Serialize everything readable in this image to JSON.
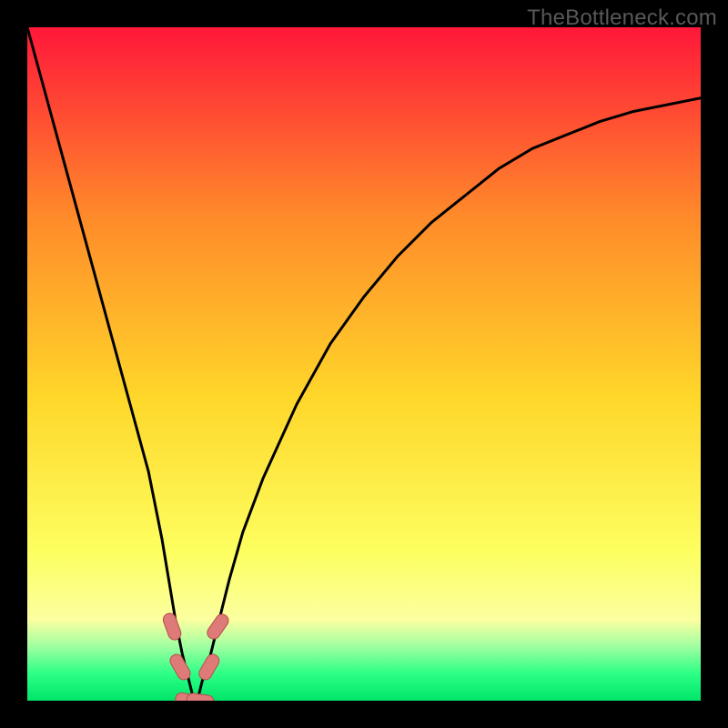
{
  "watermark": "TheBottleneck.com",
  "chart_data": {
    "type": "line",
    "title": "",
    "xlabel": "",
    "ylabel": "",
    "xlim": [
      0,
      100
    ],
    "ylim": [
      0,
      100
    ],
    "series": [
      {
        "name": "bottleneck-curve",
        "x": [
          0,
          3,
          6,
          9,
          12,
          15,
          18,
          20,
          21,
          22,
          23,
          24,
          24.5,
          25,
          25.5,
          26,
          27,
          28,
          29,
          30,
          32,
          35,
          40,
          45,
          50,
          55,
          60,
          65,
          70,
          75,
          80,
          85,
          90,
          95,
          100
        ],
        "values": [
          100,
          89,
          78,
          67,
          56,
          45,
          34,
          24,
          18,
          12,
          7,
          3,
          1,
          0,
          1,
          3,
          6,
          10,
          14,
          18,
          25,
          33,
          44,
          53,
          60,
          66,
          71,
          75,
          79,
          82,
          84,
          86,
          87.5,
          88.5,
          89.5
        ]
      }
    ],
    "markers": [
      {
        "x": 21.5,
        "y": 11,
        "angle": 70
      },
      {
        "x": 22.7,
        "y": 5,
        "angle": 60
      },
      {
        "x": 24.0,
        "y": 0,
        "angle": 12
      },
      {
        "x": 25.7,
        "y": 0,
        "angle": 8
      },
      {
        "x": 27.0,
        "y": 5,
        "angle": -60
      },
      {
        "x": 28.3,
        "y": 11,
        "angle": -55
      }
    ],
    "colors": {
      "gradient_top": "#ff173a",
      "gradient_mid1": "#ff8a2a",
      "gradient_mid2": "#ffd72a",
      "gradient_mid3": "#fdff60",
      "gradient_low": "#fbffa0",
      "gradient_green1": "#9effa0",
      "gradient_green2": "#2cff85",
      "gradient_bottom": "#00e56a",
      "curve": "#000000",
      "marker_fill": "#de7a78",
      "marker_stroke": "#b94e4c"
    }
  }
}
